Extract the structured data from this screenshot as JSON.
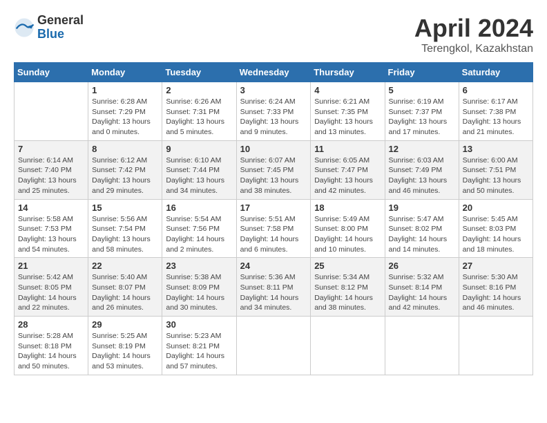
{
  "logo": {
    "general": "General",
    "blue": "Blue"
  },
  "title": "April 2024",
  "location": "Terengkol, Kazakhstan",
  "days_header": [
    "Sunday",
    "Monday",
    "Tuesday",
    "Wednesday",
    "Thursday",
    "Friday",
    "Saturday"
  ],
  "weeks": [
    [
      {
        "day": "",
        "info": ""
      },
      {
        "day": "1",
        "info": "Sunrise: 6:28 AM\nSunset: 7:29 PM\nDaylight: 13 hours\nand 0 minutes."
      },
      {
        "day": "2",
        "info": "Sunrise: 6:26 AM\nSunset: 7:31 PM\nDaylight: 13 hours\nand 5 minutes."
      },
      {
        "day": "3",
        "info": "Sunrise: 6:24 AM\nSunset: 7:33 PM\nDaylight: 13 hours\nand 9 minutes."
      },
      {
        "day": "4",
        "info": "Sunrise: 6:21 AM\nSunset: 7:35 PM\nDaylight: 13 hours\nand 13 minutes."
      },
      {
        "day": "5",
        "info": "Sunrise: 6:19 AM\nSunset: 7:37 PM\nDaylight: 13 hours\nand 17 minutes."
      },
      {
        "day": "6",
        "info": "Sunrise: 6:17 AM\nSunset: 7:38 PM\nDaylight: 13 hours\nand 21 minutes."
      }
    ],
    [
      {
        "day": "7",
        "info": "Sunrise: 6:14 AM\nSunset: 7:40 PM\nDaylight: 13 hours\nand 25 minutes."
      },
      {
        "day": "8",
        "info": "Sunrise: 6:12 AM\nSunset: 7:42 PM\nDaylight: 13 hours\nand 29 minutes."
      },
      {
        "day": "9",
        "info": "Sunrise: 6:10 AM\nSunset: 7:44 PM\nDaylight: 13 hours\nand 34 minutes."
      },
      {
        "day": "10",
        "info": "Sunrise: 6:07 AM\nSunset: 7:45 PM\nDaylight: 13 hours\nand 38 minutes."
      },
      {
        "day": "11",
        "info": "Sunrise: 6:05 AM\nSunset: 7:47 PM\nDaylight: 13 hours\nand 42 minutes."
      },
      {
        "day": "12",
        "info": "Sunrise: 6:03 AM\nSunset: 7:49 PM\nDaylight: 13 hours\nand 46 minutes."
      },
      {
        "day": "13",
        "info": "Sunrise: 6:00 AM\nSunset: 7:51 PM\nDaylight: 13 hours\nand 50 minutes."
      }
    ],
    [
      {
        "day": "14",
        "info": "Sunrise: 5:58 AM\nSunset: 7:53 PM\nDaylight: 13 hours\nand 54 minutes."
      },
      {
        "day": "15",
        "info": "Sunrise: 5:56 AM\nSunset: 7:54 PM\nDaylight: 13 hours\nand 58 minutes."
      },
      {
        "day": "16",
        "info": "Sunrise: 5:54 AM\nSunset: 7:56 PM\nDaylight: 14 hours\nand 2 minutes."
      },
      {
        "day": "17",
        "info": "Sunrise: 5:51 AM\nSunset: 7:58 PM\nDaylight: 14 hours\nand 6 minutes."
      },
      {
        "day": "18",
        "info": "Sunrise: 5:49 AM\nSunset: 8:00 PM\nDaylight: 14 hours\nand 10 minutes."
      },
      {
        "day": "19",
        "info": "Sunrise: 5:47 AM\nSunset: 8:02 PM\nDaylight: 14 hours\nand 14 minutes."
      },
      {
        "day": "20",
        "info": "Sunrise: 5:45 AM\nSunset: 8:03 PM\nDaylight: 14 hours\nand 18 minutes."
      }
    ],
    [
      {
        "day": "21",
        "info": "Sunrise: 5:42 AM\nSunset: 8:05 PM\nDaylight: 14 hours\nand 22 minutes."
      },
      {
        "day": "22",
        "info": "Sunrise: 5:40 AM\nSunset: 8:07 PM\nDaylight: 14 hours\nand 26 minutes."
      },
      {
        "day": "23",
        "info": "Sunrise: 5:38 AM\nSunset: 8:09 PM\nDaylight: 14 hours\nand 30 minutes."
      },
      {
        "day": "24",
        "info": "Sunrise: 5:36 AM\nSunset: 8:11 PM\nDaylight: 14 hours\nand 34 minutes."
      },
      {
        "day": "25",
        "info": "Sunrise: 5:34 AM\nSunset: 8:12 PM\nDaylight: 14 hours\nand 38 minutes."
      },
      {
        "day": "26",
        "info": "Sunrise: 5:32 AM\nSunset: 8:14 PM\nDaylight: 14 hours\nand 42 minutes."
      },
      {
        "day": "27",
        "info": "Sunrise: 5:30 AM\nSunset: 8:16 PM\nDaylight: 14 hours\nand 46 minutes."
      }
    ],
    [
      {
        "day": "28",
        "info": "Sunrise: 5:28 AM\nSunset: 8:18 PM\nDaylight: 14 hours\nand 50 minutes."
      },
      {
        "day": "29",
        "info": "Sunrise: 5:25 AM\nSunset: 8:19 PM\nDaylight: 14 hours\nand 53 minutes."
      },
      {
        "day": "30",
        "info": "Sunrise: 5:23 AM\nSunset: 8:21 PM\nDaylight: 14 hours\nand 57 minutes."
      },
      {
        "day": "",
        "info": ""
      },
      {
        "day": "",
        "info": ""
      },
      {
        "day": "",
        "info": ""
      },
      {
        "day": "",
        "info": ""
      }
    ]
  ]
}
